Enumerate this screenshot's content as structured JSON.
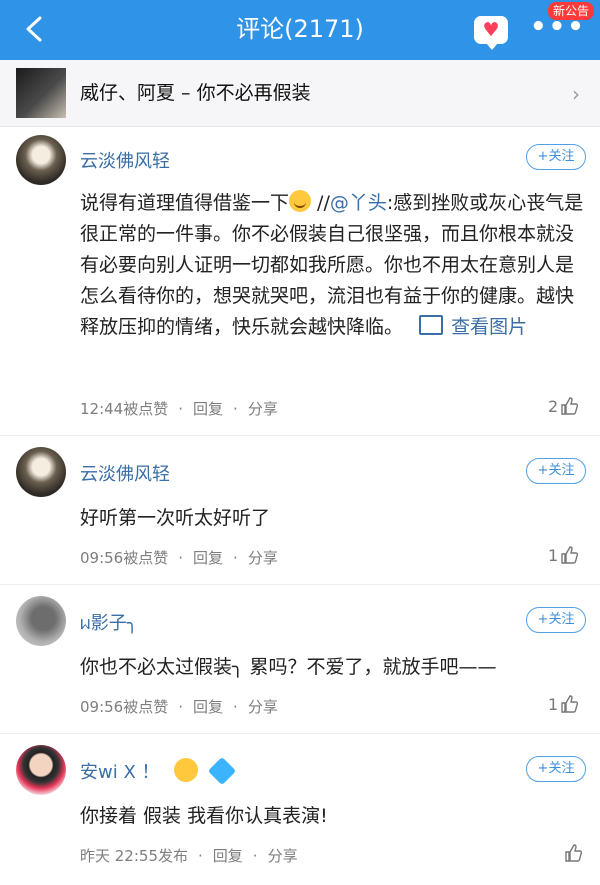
{
  "header": {
    "title": "评论(2171)",
    "badge": "新公告",
    "more": "•••",
    "heart": "♥"
  },
  "song": {
    "title": "威仔、阿夏 – 你不必再假装",
    "chevron": "›"
  },
  "comments": [
    {
      "user": "云淡佛风轻",
      "follow": "+关注",
      "text_part1": "说得有道理值得借鉴一下",
      "text_sep": " //",
      "mention": "@丫头",
      "text_part2": ":感到挫败或灰心丧气是很正常的一件事。你不必假装自己很坚强，而且你根本就没有必要向别人证明一切都如我所愿。你也不用太在意别人是怎么看待你的，想哭就哭吧，流泪也有益于你的健康。越快释放压抑的情绪，快乐就会越快降临。",
      "view_image": "查看图片",
      "time": "12:44被点赞",
      "reply": "回复",
      "share": "分享",
      "sep": "·",
      "likes": "2"
    },
    {
      "user": "云淡佛风轻",
      "follow": "+关注",
      "text": "好听第一次听太好听了",
      "time": "09:56被点赞",
      "reply": "回复",
      "share": "分享",
      "sep": "·",
      "likes": "1"
    },
    {
      "user": "ᥕ影子╮",
      "follow": "+关注",
      "text": "你也不必太过假装╮ 累吗？不爱了，就放手吧——",
      "time": "09:56被点赞",
      "reply": "回复",
      "share": "分享",
      "sep": "·",
      "likes": "1"
    },
    {
      "user": "安wi X ！",
      "follow": "+关注",
      "text": "你接着 假装 我看你认真表演!",
      "time": "昨天 22:55发布",
      "reply": "回复",
      "share": "分享",
      "sep": "·",
      "likes": ""
    }
  ],
  "colors": {
    "header": "#2f93e8",
    "username": "#3a6ea5",
    "follow_border": "#53a0e6",
    "badge": "#ff3a3a"
  },
  "icons": [
    "back-arrow-icon",
    "heart-icon",
    "more-icon",
    "chevron-right-icon",
    "image-icon",
    "thumbs-up-icon",
    "grin-emoji-icon",
    "sad-emoji-icon",
    "diamond-icon"
  ]
}
